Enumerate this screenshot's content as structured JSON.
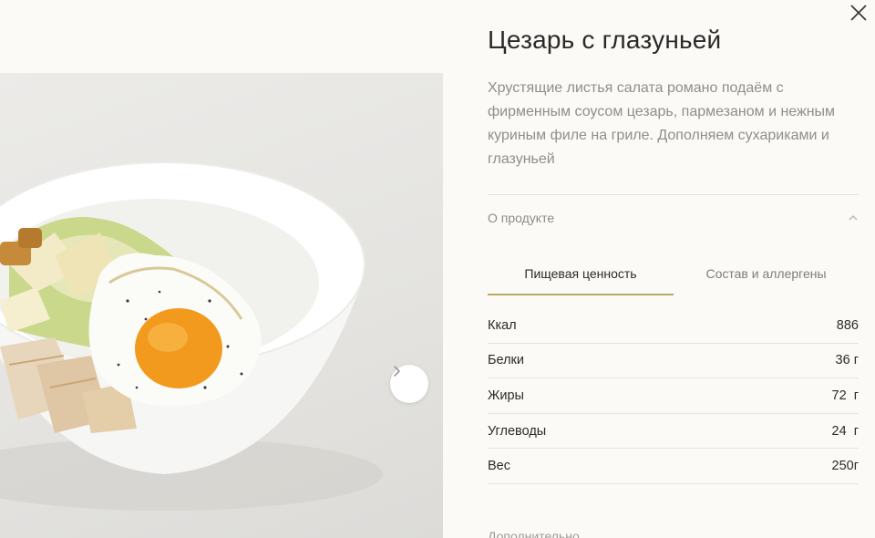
{
  "product": {
    "title": "Цезарь с глазуньей",
    "description": "Хрустящие листья салата романо подаём с фирменным соусом цезарь, пармезаном и нежным куриным филе на гриле. Дополняем сухариками и глазуньей"
  },
  "about_section": {
    "label": "О продукте",
    "expanded": true,
    "chevron_icon": "chevron-up-icon"
  },
  "tabs": [
    {
      "label": "Пищевая ценность",
      "active": true
    },
    {
      "label": "Состав и аллергены",
      "active": false
    }
  ],
  "nutrition": [
    {
      "label": "Ккал",
      "value": "886"
    },
    {
      "label": "Белки",
      "value": "36 г"
    },
    {
      "label": "Жиры",
      "value": "72  г"
    },
    {
      "label": "Углеводы",
      "value": "24  г"
    },
    {
      "label": "Вес",
      "value": "250г"
    }
  ],
  "more_section": {
    "label": "Дополнительно"
  },
  "icons": {
    "close": "close-icon",
    "next": "chevron-right-icon"
  },
  "colors": {
    "accent": "#b8a865",
    "background": "#fbfaf6",
    "muted_text": "#8e8e8e"
  }
}
